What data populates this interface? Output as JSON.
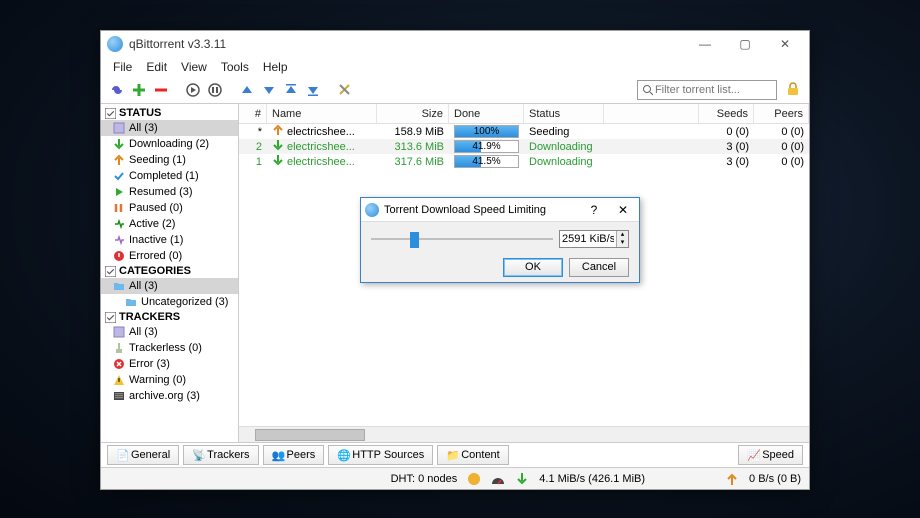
{
  "window": {
    "title": "qBittorrent v3.3.11"
  },
  "menu": {
    "file": "File",
    "edit": "Edit",
    "view": "View",
    "tools": "Tools",
    "help": "Help"
  },
  "search": {
    "placeholder": "Filter torrent list..."
  },
  "sidebar": {
    "status_hdr": "STATUS",
    "status": [
      {
        "label": "All (3)",
        "icon": "all",
        "sel": true
      },
      {
        "label": "Downloading (2)",
        "icon": "down"
      },
      {
        "label": "Seeding (1)",
        "icon": "up"
      },
      {
        "label": "Completed (1)",
        "icon": "check"
      },
      {
        "label": "Resumed (3)",
        "icon": "play"
      },
      {
        "label": "Paused (0)",
        "icon": "pause"
      },
      {
        "label": "Active (2)",
        "icon": "active"
      },
      {
        "label": "Inactive (1)",
        "icon": "inactive"
      },
      {
        "label": "Errored (0)",
        "icon": "error"
      }
    ],
    "cat_hdr": "CATEGORIES",
    "categories": [
      {
        "label": "All  (3)",
        "sel": true
      },
      {
        "label": "Uncategorized  (3)"
      }
    ],
    "trk_hdr": "TRACKERS",
    "trackers": [
      {
        "label": "All (3)",
        "icon": "all"
      },
      {
        "label": "Trackerless (0)",
        "icon": "trackerless"
      },
      {
        "label": "Error (3)",
        "icon": "err"
      },
      {
        "label": "Warning (0)",
        "icon": "warn"
      },
      {
        "label": "archive.org (3)",
        "icon": "host"
      }
    ]
  },
  "columns": {
    "num": "#",
    "name": "Name",
    "size": "Size",
    "done": "Done",
    "status": "Status",
    "seeds": "Seeds",
    "peers": "Peers"
  },
  "rows": [
    {
      "num": "*",
      "name": "electricshee...",
      "size": "158.9 MiB",
      "pct": 100,
      "donetxt": "100%",
      "status": "Seeding",
      "seeds": "0 (0)",
      "peers": "0 (0)",
      "dl": false
    },
    {
      "num": "2",
      "name": "electricshee...",
      "size": "313.6 MiB",
      "pct": 42,
      "donetxt": "41.9%",
      "status": "Downloading",
      "seeds": "3 (0)",
      "peers": "0 (0)",
      "dl": true
    },
    {
      "num": "1",
      "name": "electricshee...",
      "size": "317.6 MiB",
      "pct": 42,
      "donetxt": "41.5%",
      "status": "Downloading",
      "seeds": "3 (0)",
      "peers": "0 (0)",
      "dl": true
    }
  ],
  "tabs": {
    "general": "General",
    "trackers": "Trackers",
    "peers": "Peers",
    "http": "HTTP Sources",
    "content": "Content",
    "speed": "Speed"
  },
  "statusbar": {
    "dht": "DHT: 0 nodes",
    "down": "4.1 MiB/s (426.1 MiB)",
    "up": "0 B/s (0 B)"
  },
  "dialog": {
    "title": "Torrent Download Speed Limiting",
    "help": "?",
    "close": "✕",
    "value": "2591 KiB/s",
    "ok": "OK",
    "cancel": "Cancel"
  }
}
